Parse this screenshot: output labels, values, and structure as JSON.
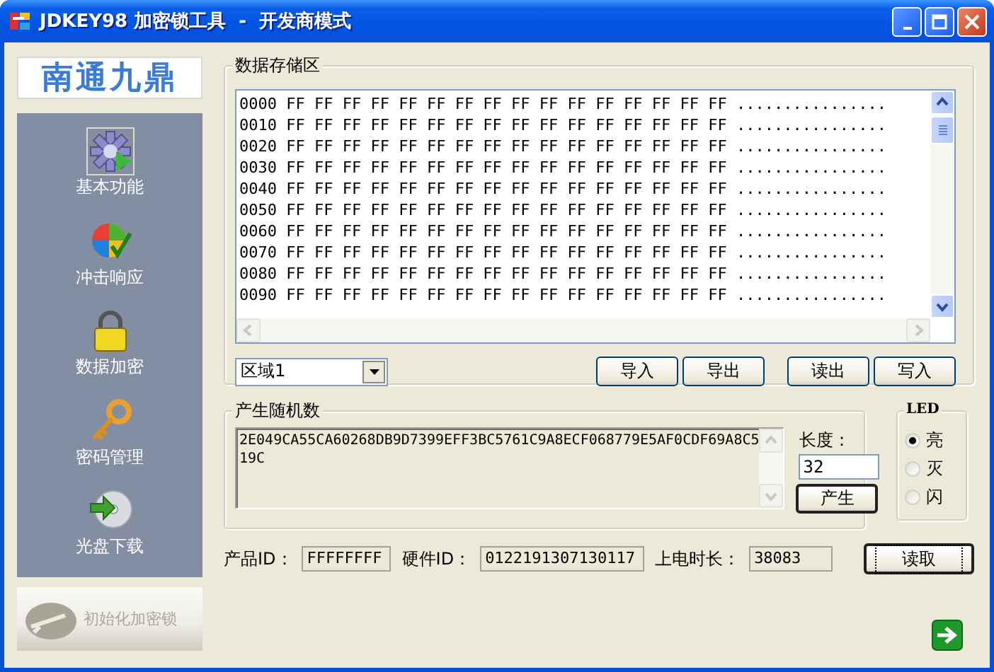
{
  "window": {
    "title": "JDKEY98 加密锁工具  -  开发商模式"
  },
  "sidebar": {
    "logo": "南通九鼎",
    "items": [
      {
        "label": "基本功能",
        "selected": true
      },
      {
        "label": "冲击响应",
        "selected": false
      },
      {
        "label": "数据加密",
        "selected": false
      },
      {
        "label": "密码管理",
        "selected": false
      },
      {
        "label": "光盘下载",
        "selected": false
      }
    ],
    "init_button": {
      "label": "初始化加密锁",
      "disabled": true
    }
  },
  "storage": {
    "title": "数据存储区",
    "rows": [
      "0000 FF FF FF FF FF FF FF FF FF FF FF FF FF FF FF FF ................",
      "0010 FF FF FF FF FF FF FF FF FF FF FF FF FF FF FF FF ................",
      "0020 FF FF FF FF FF FF FF FF FF FF FF FF FF FF FF FF ................",
      "0030 FF FF FF FF FF FF FF FF FF FF FF FF FF FF FF FF ................",
      "0040 FF FF FF FF FF FF FF FF FF FF FF FF FF FF FF FF ................",
      "0050 FF FF FF FF FF FF FF FF FF FF FF FF FF FF FF FF ................",
      "0060 FF FF FF FF FF FF FF FF FF FF FF FF FF FF FF FF ................",
      "0070 FF FF FF FF FF FF FF FF FF FF FF FF FF FF FF FF ................",
      "0080 FF FF FF FF FF FF FF FF FF FF FF FF FF FF FF FF ................",
      "0090 FF FF FF FF FF FF FF FF FF FF FF FF FF FF FF FF ................"
    ],
    "region_select": "区域1",
    "buttons": [
      "导入",
      "导出",
      "读出",
      "写入"
    ]
  },
  "random": {
    "title": "产生随机数",
    "output": "2E049CA55CA60268DB9D7399EFF3BC5761C9A8ECF068779E5AF0CDF69A8C519C",
    "length_label": "长度：",
    "length_value": "32",
    "generate_button": "产生"
  },
  "led": {
    "title": "LED",
    "options": [
      {
        "label": "亮",
        "selected": true
      },
      {
        "label": "灭",
        "selected": false
      },
      {
        "label": "闪",
        "selected": false
      }
    ]
  },
  "info": {
    "fields": [
      {
        "label": "产品ID：",
        "value": "FFFFFFFF"
      },
      {
        "label": "硬件ID：",
        "value": "0122191307130117"
      },
      {
        "label": "上电时长：",
        "value": "38083"
      }
    ],
    "read_button": "读取"
  }
}
